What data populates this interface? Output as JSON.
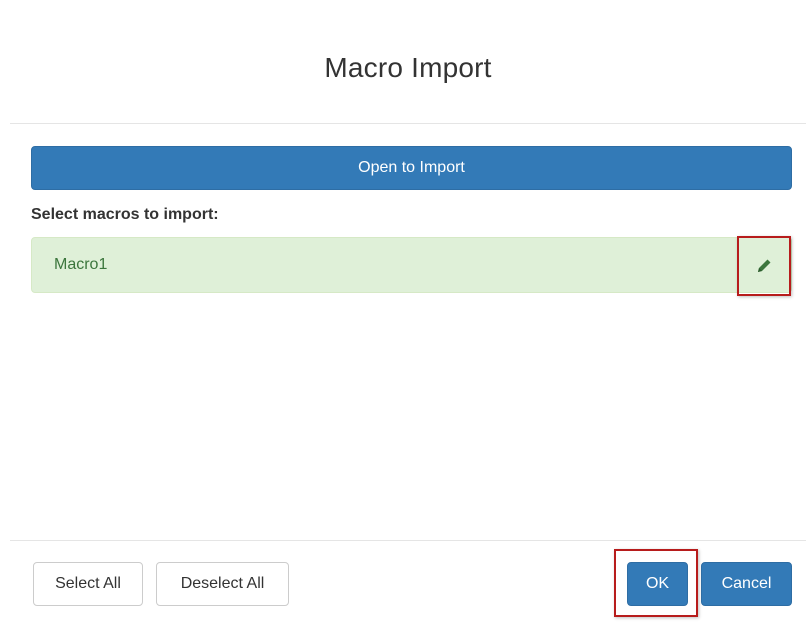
{
  "dialog": {
    "title": "Macro Import"
  },
  "import": {
    "open_label": "Open to Import",
    "section_label": "Select macros to import:"
  },
  "macros": [
    {
      "name": "Macro1",
      "selected": true,
      "edit_icon": "pencil-icon"
    }
  ],
  "footer": {
    "select_all_label": "Select All",
    "deselect_all_label": "Deselect All",
    "ok_label": "OK",
    "cancel_label": "Cancel"
  },
  "colors": {
    "primary": "#337ab7",
    "selected_bg": "#dff0d8",
    "selected_text": "#3c763d",
    "highlight_box": "#b71c1c"
  }
}
